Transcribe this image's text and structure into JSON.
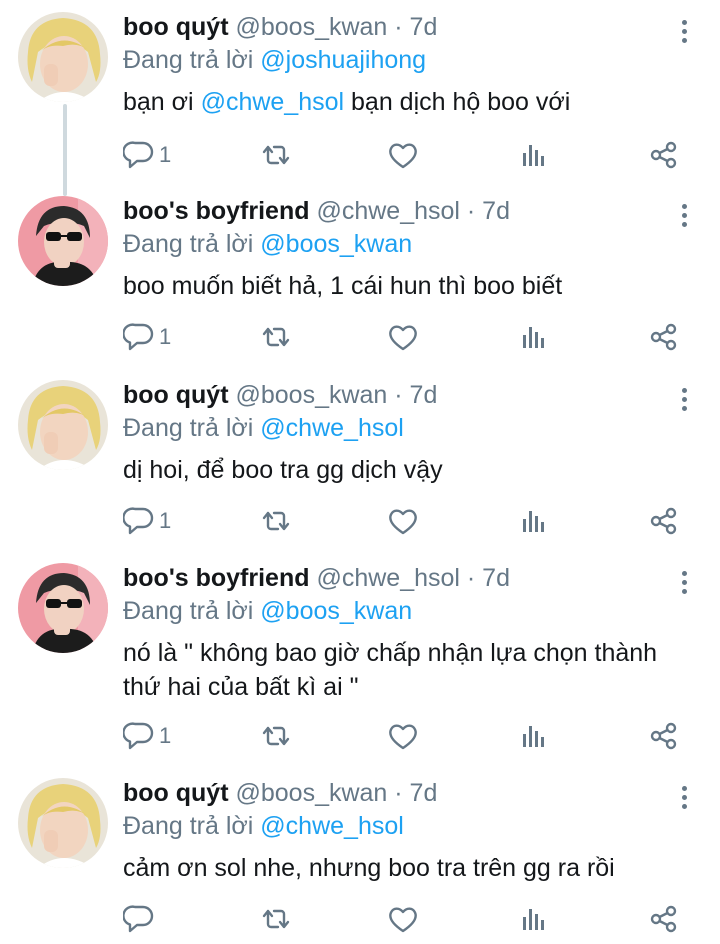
{
  "replying_prefix": "Đang trả lời",
  "tweets": [
    {
      "name": "boo quýt",
      "handle_meta": "@boos_kwan · 7d",
      "replying_to": "@joshuajihong",
      "text_pre": "bạn ơi ",
      "text_mention": "@chwe_hsol",
      "text_post": " bạn dịch hộ boo với",
      "reply_count": "1"
    },
    {
      "name": "boo's boyfriend",
      "handle_meta": "@chwe_hsol · 7d",
      "replying_to": "@boos_kwan",
      "text": "boo muốn biết hả, 1 cái hun thì boo biết",
      "reply_count": "1"
    },
    {
      "name": "boo quýt",
      "handle_meta": "@boos_kwan · 7d",
      "replying_to": "@chwe_hsol",
      "text": "dị hoi, để boo tra gg dịch vậy",
      "reply_count": "1"
    },
    {
      "name": "boo's boyfriend",
      "handle_meta": "@chwe_hsol · 7d",
      "replying_to": "@boos_kwan",
      "text": "nó là \" không bao giờ chấp nhận lựa chọn thành thứ hai của bất kì ai \"",
      "reply_count": "1"
    },
    {
      "name": "boo quýt",
      "handle_meta": "@boos_kwan · 7d",
      "replying_to": "@chwe_hsol",
      "text": "cảm ơn sol nhe, nhưng boo tra trên gg ra rồi",
      "reply_count": ""
    }
  ],
  "colors": {
    "text": "#14171a",
    "secondary": "#657786",
    "link": "#1da1f2",
    "thread_line": "#cfd9de"
  },
  "icons": {
    "reply": "reply-icon",
    "retweet": "retweet-icon",
    "like": "heart-icon",
    "analytics": "analytics-icon",
    "share": "share-icon",
    "more": "more-vertical-icon"
  }
}
